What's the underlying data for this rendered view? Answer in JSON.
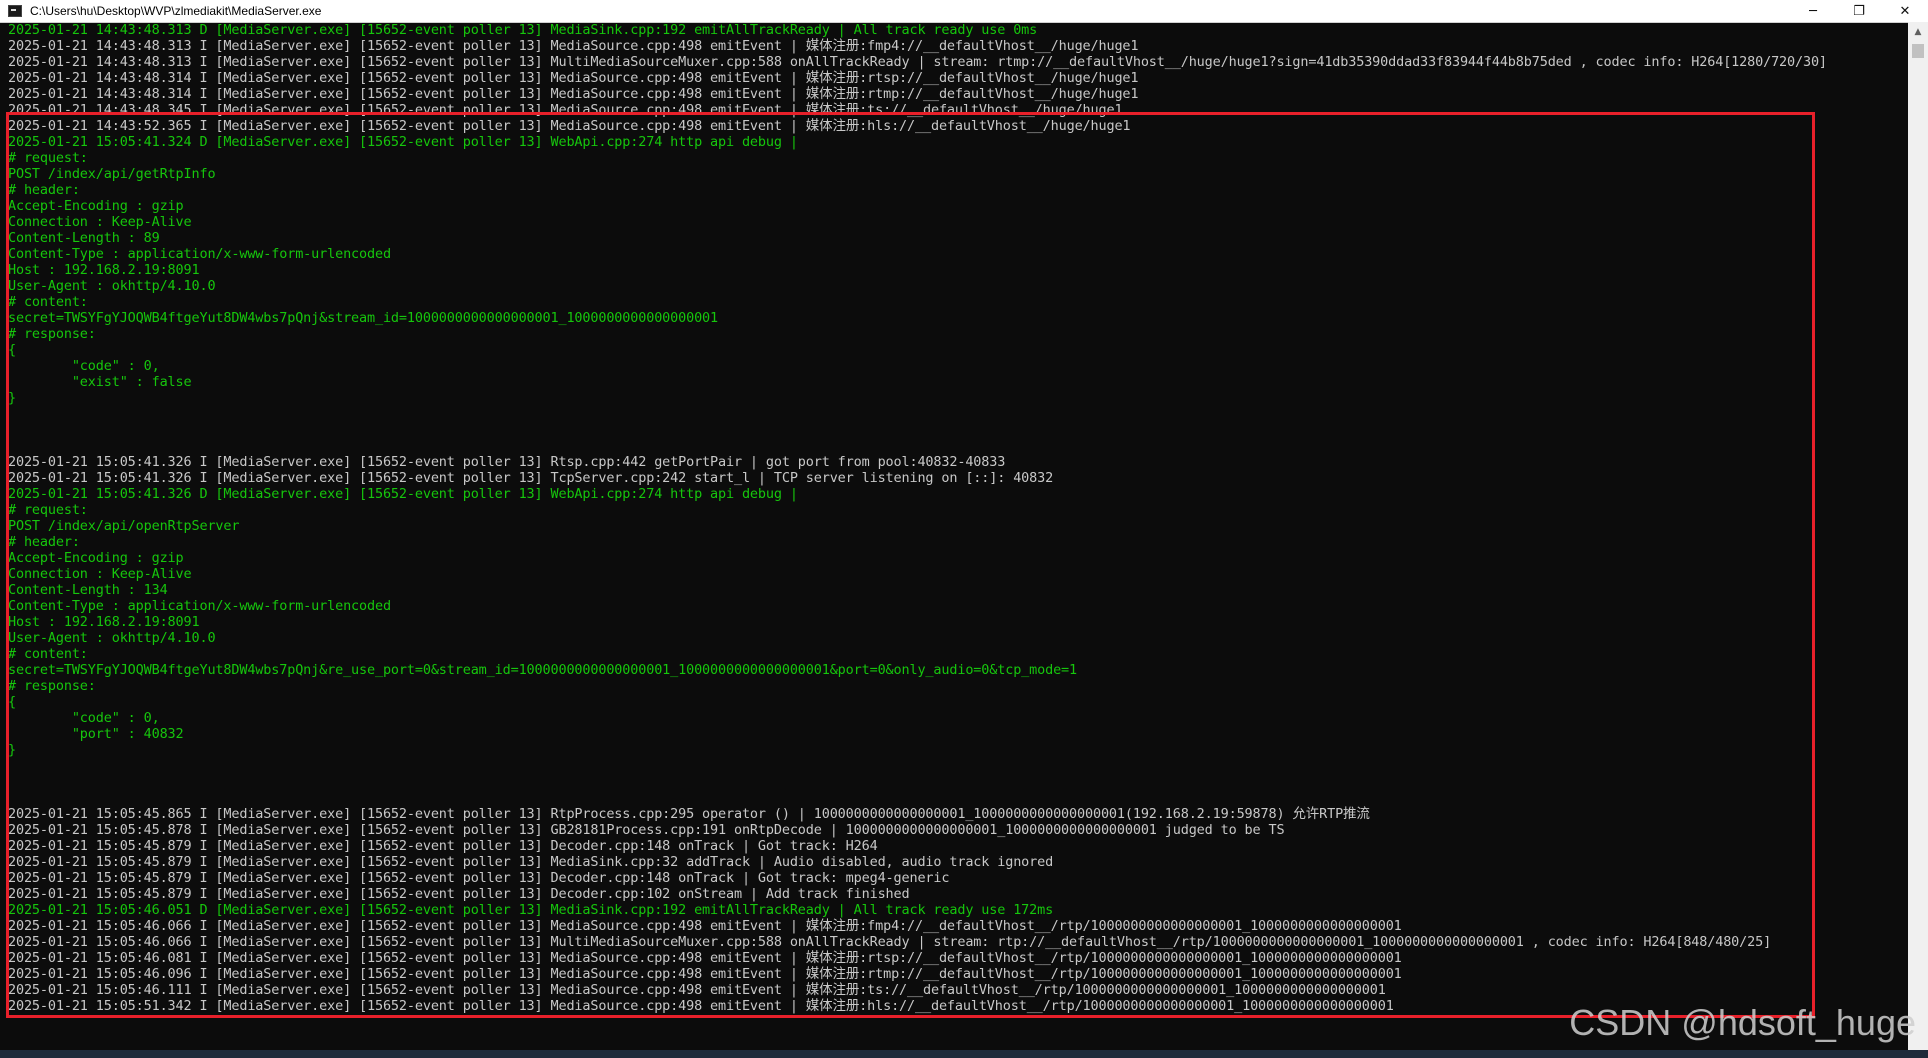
{
  "window": {
    "title": "C:\\Users\\hu\\Desktop\\WVP\\zlmediakit\\MediaServer.exe",
    "minimize_glyph": "─",
    "restore_glyph": "❐",
    "close_glyph": "✕"
  },
  "colors": {
    "white": "#c8c8c8",
    "green": "#16c60c",
    "highlight": "#e8202a"
  },
  "lines": [
    {
      "c": "g",
      "t": "2025-01-21 14:43:48.313 D [MediaServer.exe] [15652-event poller 13] MediaSink.cpp:192 emitAllTrackReady | All track ready use 0ms"
    },
    {
      "c": "w",
      "t": "2025-01-21 14:43:48.313 I [MediaServer.exe] [15652-event poller 13] MediaSource.cpp:498 emitEvent | 媒体注册:fmp4://__defaultVhost__/huge/huge1"
    },
    {
      "c": "w",
      "t": "2025-01-21 14:43:48.313 I [MediaServer.exe] [15652-event poller 13] MultiMediaSourceMuxer.cpp:588 onAllTrackReady | stream: rtmp://__defaultVhost__/huge/huge1?sign=41db35390ddad33f83944f44b8b75ded , codec info: H264[1280/720/30]"
    },
    {
      "c": "w",
      "t": "2025-01-21 14:43:48.314 I [MediaServer.exe] [15652-event poller 13] MediaSource.cpp:498 emitEvent | 媒体注册:rtsp://__defaultVhost__/huge/huge1"
    },
    {
      "c": "w",
      "t": "2025-01-21 14:43:48.314 I [MediaServer.exe] [15652-event poller 13] MediaSource.cpp:498 emitEvent | 媒体注册:rtmp://__defaultVhost__/huge/huge1"
    },
    {
      "c": "w",
      "t": "2025-01-21 14:43:48.345 I [MediaServer.exe] [15652-event poller 13] MediaSource.cpp:498 emitEvent | 媒体注册:ts://__defaultVhost__/huge/huge1"
    },
    {
      "c": "w",
      "t": "2025-01-21 14:43:52.365 I [MediaServer.exe] [15652-event poller 13] MediaSource.cpp:498 emitEvent | 媒体注册:hls://__defaultVhost__/huge/huge1"
    },
    {
      "c": "g",
      "t": "2025-01-21 15:05:41.324 D [MediaServer.exe] [15652-event poller 13] WebApi.cpp:274 http api debug |"
    },
    {
      "c": "g",
      "t": "# request:"
    },
    {
      "c": "g",
      "t": "POST /index/api/getRtpInfo"
    },
    {
      "c": "g",
      "t": "# header:"
    },
    {
      "c": "g",
      "t": "Accept-Encoding : gzip"
    },
    {
      "c": "g",
      "t": "Connection : Keep-Alive"
    },
    {
      "c": "g",
      "t": "Content-Length : 89"
    },
    {
      "c": "g",
      "t": "Content-Type : application/x-www-form-urlencoded"
    },
    {
      "c": "g",
      "t": "Host : 192.168.2.19:8091"
    },
    {
      "c": "g",
      "t": "User-Agent : okhttp/4.10.0"
    },
    {
      "c": "g",
      "t": "# content:"
    },
    {
      "c": "g",
      "t": "secret=TWSYFgYJOQWB4ftgeYut8DW4wbs7pQnj&stream_id=1000000000000000001_1000000000000000001"
    },
    {
      "c": "g",
      "t": "# response:"
    },
    {
      "c": "g",
      "t": "{"
    },
    {
      "c": "g",
      "t": "        \"code\" : 0,"
    },
    {
      "c": "g",
      "t": "        \"exist\" : false"
    },
    {
      "c": "g",
      "t": "}"
    },
    {
      "c": "g",
      "t": ""
    },
    {
      "c": "g",
      "t": ""
    },
    {
      "c": "g",
      "t": ""
    },
    {
      "c": "w",
      "t": "2025-01-21 15:05:41.326 I [MediaServer.exe] [15652-event poller 13] Rtsp.cpp:442 getPortPair | got port from pool:40832-40833"
    },
    {
      "c": "w",
      "t": "2025-01-21 15:05:41.326 I [MediaServer.exe] [15652-event poller 13] TcpServer.cpp:242 start_l | TCP server listening on [::]: 40832"
    },
    {
      "c": "g",
      "t": "2025-01-21 15:05:41.326 D [MediaServer.exe] [15652-event poller 13] WebApi.cpp:274 http api debug |"
    },
    {
      "c": "g",
      "t": "# request:"
    },
    {
      "c": "g",
      "t": "POST /index/api/openRtpServer"
    },
    {
      "c": "g",
      "t": "# header:"
    },
    {
      "c": "g",
      "t": "Accept-Encoding : gzip"
    },
    {
      "c": "g",
      "t": "Connection : Keep-Alive"
    },
    {
      "c": "g",
      "t": "Content-Length : 134"
    },
    {
      "c": "g",
      "t": "Content-Type : application/x-www-form-urlencoded"
    },
    {
      "c": "g",
      "t": "Host : 192.168.2.19:8091"
    },
    {
      "c": "g",
      "t": "User-Agent : okhttp/4.10.0"
    },
    {
      "c": "g",
      "t": "# content:"
    },
    {
      "c": "g",
      "t": "secret=TWSYFgYJOQWB4ftgeYut8DW4wbs7pQnj&re_use_port=0&stream_id=1000000000000000001_1000000000000000001&port=0&only_audio=0&tcp_mode=1"
    },
    {
      "c": "g",
      "t": "# response:"
    },
    {
      "c": "g",
      "t": "{"
    },
    {
      "c": "g",
      "t": "        \"code\" : 0,"
    },
    {
      "c": "g",
      "t": "        \"port\" : 40832"
    },
    {
      "c": "g",
      "t": "}"
    },
    {
      "c": "g",
      "t": ""
    },
    {
      "c": "g",
      "t": ""
    },
    {
      "c": "g",
      "t": ""
    },
    {
      "c": "w",
      "t": "2025-01-21 15:05:45.865 I [MediaServer.exe] [15652-event poller 13] RtpProcess.cpp:295 operator () | 1000000000000000001_1000000000000000001(192.168.2.19:59878) 允许RTP推流"
    },
    {
      "c": "w",
      "t": "2025-01-21 15:05:45.878 I [MediaServer.exe] [15652-event poller 13] GB28181Process.cpp:191 onRtpDecode | 1000000000000000001_1000000000000000001 judged to be TS"
    },
    {
      "c": "w",
      "t": "2025-01-21 15:05:45.879 I [MediaServer.exe] [15652-event poller 13] Decoder.cpp:148 onTrack | Got track: H264"
    },
    {
      "c": "w",
      "t": "2025-01-21 15:05:45.879 I [MediaServer.exe] [15652-event poller 13] MediaSink.cpp:32 addTrack | Audio disabled, audio track ignored"
    },
    {
      "c": "w",
      "t": "2025-01-21 15:05:45.879 I [MediaServer.exe] [15652-event poller 13] Decoder.cpp:148 onTrack | Got track: mpeg4-generic"
    },
    {
      "c": "w",
      "t": "2025-01-21 15:05:45.879 I [MediaServer.exe] [15652-event poller 13] Decoder.cpp:102 onStream | Add track finished"
    },
    {
      "c": "g",
      "t": "2025-01-21 15:05:46.051 D [MediaServer.exe] [15652-event poller 13] MediaSink.cpp:192 emitAllTrackReady | All track ready use 172ms"
    },
    {
      "c": "w",
      "t": "2025-01-21 15:05:46.066 I [MediaServer.exe] [15652-event poller 13] MediaSource.cpp:498 emitEvent | 媒体注册:fmp4://__defaultVhost__/rtp/1000000000000000001_1000000000000000001"
    },
    {
      "c": "w",
      "t": "2025-01-21 15:05:46.066 I [MediaServer.exe] [15652-event poller 13] MultiMediaSourceMuxer.cpp:588 onAllTrackReady | stream: rtp://__defaultVhost__/rtp/1000000000000000001_1000000000000000001 , codec info: H264[848/480/25]"
    },
    {
      "c": "w",
      "t": "2025-01-21 15:05:46.081 I [MediaServer.exe] [15652-event poller 13] MediaSource.cpp:498 emitEvent | 媒体注册:rtsp://__defaultVhost__/rtp/1000000000000000001_1000000000000000001"
    },
    {
      "c": "w",
      "t": "2025-01-21 15:05:46.096 I [MediaServer.exe] [15652-event poller 13] MediaSource.cpp:498 emitEvent | 媒体注册:rtmp://__defaultVhost__/rtp/1000000000000000001_1000000000000000001"
    },
    {
      "c": "w",
      "t": "2025-01-21 15:05:46.111 I [MediaServer.exe] [15652-event poller 13] MediaSource.cpp:498 emitEvent | 媒体注册:ts://__defaultVhost__/rtp/1000000000000000001_1000000000000000001"
    },
    {
      "c": "w",
      "t": "2025-01-21 15:05:51.342 I [MediaServer.exe] [15652-event poller 13] MediaSource.cpp:498 emitEvent | 媒体注册:hls://__defaultVhost__/rtp/1000000000000000001_1000000000000000001"
    }
  ],
  "watermark": "CSDN @hdsoft_huge"
}
